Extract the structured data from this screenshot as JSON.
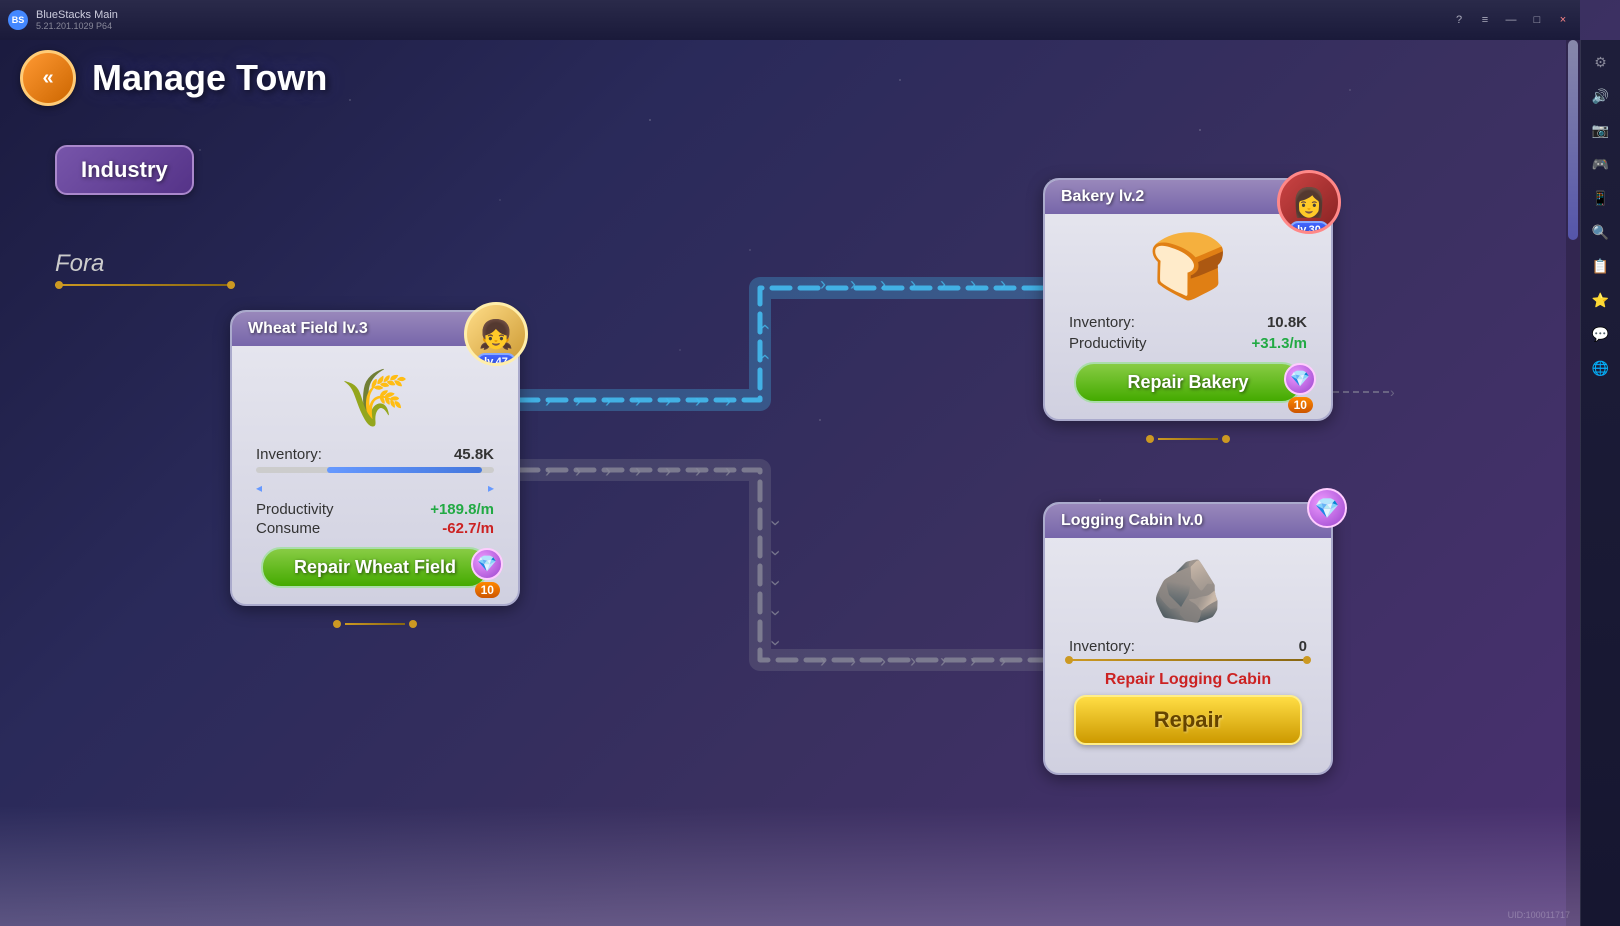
{
  "app": {
    "title": "BlueStacks Main",
    "version": "5.21.201.1029  P64"
  },
  "window_controls": {
    "help": "?",
    "menu": "≡",
    "minimize": "—",
    "maximize": "□",
    "close": "×"
  },
  "page": {
    "title": "Manage Town",
    "back_btn": "«"
  },
  "industry_btn": {
    "label": "Industry"
  },
  "fora_section": {
    "label": "Fora"
  },
  "wheat_field": {
    "card_title": "Wheat Field lv.3",
    "avatar_level": "lv.47",
    "inventory_label": "Inventory:",
    "inventory_value": "45.8K",
    "productivity_label": "Productivity",
    "productivity_value": "+189.8/m",
    "consume_label": "Consume",
    "consume_value": "-62.7/m",
    "repair_btn_label": "Repair Wheat Field",
    "repair_cost": "10"
  },
  "bakery": {
    "card_title": "Bakery lv.2",
    "avatar_level": "lv.30",
    "inventory_label": "Inventory:",
    "inventory_value": "10.8K",
    "productivity_label": "Productivity",
    "productivity_value": "+31.3/m",
    "repair_btn_label": "Repair Bakery",
    "repair_cost": "10"
  },
  "logging_cabin": {
    "card_title": "Logging Cabin lv.0",
    "inventory_label": "Inventory:",
    "inventory_value": "0",
    "repair_logging_label": "Repair Logging Cabin",
    "repair_btn_label": "Repair"
  },
  "colors": {
    "accent_blue": "#4488ff",
    "accent_green": "#44aa00",
    "accent_gold": "#cc9900",
    "accent_purple": "#9944cc",
    "card_bg": "#d8d8e8",
    "card_header": "#7766aa",
    "flow_blue": "#44bbee",
    "flow_gray": "#888899"
  }
}
